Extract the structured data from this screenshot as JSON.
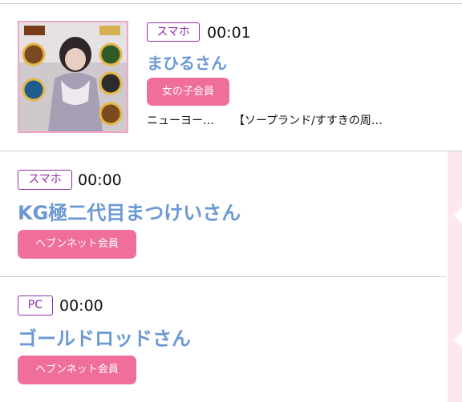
{
  "entries": [
    {
      "device": "スマホ",
      "time": "00:01",
      "name": "まひるさん",
      "member_label": "女の子会員",
      "location": "ニューヨー…",
      "shop": "【ソープランド/すすきの周…"
    },
    {
      "device": "スマホ",
      "time": "00:00",
      "name": "KG極二代目まつけいさん",
      "member_label": "ヘブンネット会員"
    },
    {
      "device": "PC",
      "time": "00:00",
      "name": "ゴールドロッドさん",
      "member_label": "ヘブンネット会員"
    }
  ],
  "colors": {
    "accent_pink": "#f06e9b",
    "name_blue": "#6c98d6",
    "badge_purple": "#8e2fa8"
  },
  "icons": [
    "ranking-medal-icon"
  ]
}
